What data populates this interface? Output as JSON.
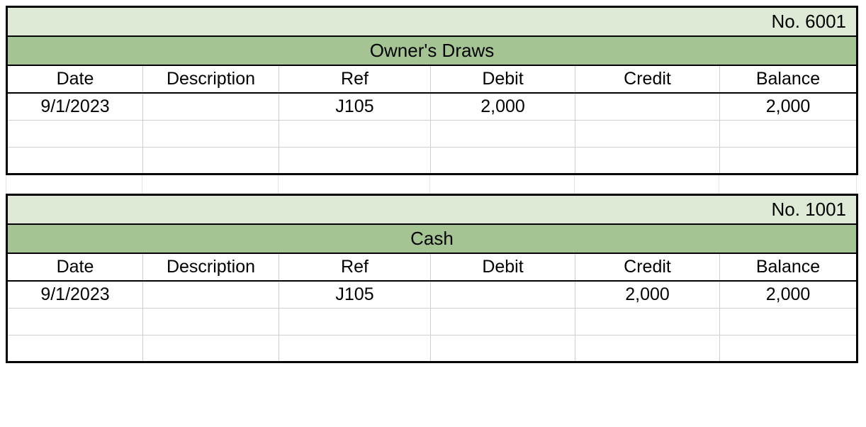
{
  "headers": {
    "date": "Date",
    "description": "Description",
    "ref": "Ref",
    "debit": "Debit",
    "credit": "Credit",
    "balance": "Balance"
  },
  "ledgers": [
    {
      "account_no_label": "No. 6001",
      "account_name": "Owner's Draws",
      "rows": [
        {
          "date": "9/1/2023",
          "description": "",
          "ref": "J105",
          "debit": "2,000",
          "credit": "",
          "balance": "2,000"
        },
        {
          "date": "",
          "description": "",
          "ref": "",
          "debit": "",
          "credit": "",
          "balance": ""
        },
        {
          "date": "",
          "description": "",
          "ref": "",
          "debit": "",
          "credit": "",
          "balance": ""
        }
      ]
    },
    {
      "account_no_label": "No. 1001",
      "account_name": "Cash",
      "rows": [
        {
          "date": "9/1/2023",
          "description": "",
          "ref": "J105",
          "debit": "",
          "credit": "2,000",
          "balance": "2,000"
        },
        {
          "date": "",
          "description": "",
          "ref": "",
          "debit": "",
          "credit": "",
          "balance": ""
        },
        {
          "date": "",
          "description": "",
          "ref": "",
          "debit": "",
          "credit": "",
          "balance": ""
        }
      ]
    }
  ]
}
